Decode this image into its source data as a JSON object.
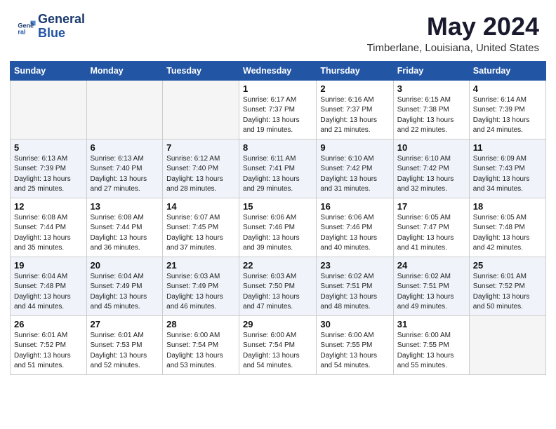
{
  "header": {
    "logo_line1": "General",
    "logo_line2": "Blue",
    "month_title": "May 2024",
    "location": "Timberlane, Louisiana, United States"
  },
  "weekdays": [
    "Sunday",
    "Monday",
    "Tuesday",
    "Wednesday",
    "Thursday",
    "Friday",
    "Saturday"
  ],
  "weeks": [
    [
      {
        "day": "",
        "sunrise": "",
        "sunset": "",
        "daylight": "",
        "empty": true
      },
      {
        "day": "",
        "sunrise": "",
        "sunset": "",
        "daylight": "",
        "empty": true
      },
      {
        "day": "",
        "sunrise": "",
        "sunset": "",
        "daylight": "",
        "empty": true
      },
      {
        "day": "1",
        "sunrise": "Sunrise: 6:17 AM",
        "sunset": "Sunset: 7:37 PM",
        "daylight": "Daylight: 13 hours and 19 minutes."
      },
      {
        "day": "2",
        "sunrise": "Sunrise: 6:16 AM",
        "sunset": "Sunset: 7:37 PM",
        "daylight": "Daylight: 13 hours and 21 minutes."
      },
      {
        "day": "3",
        "sunrise": "Sunrise: 6:15 AM",
        "sunset": "Sunset: 7:38 PM",
        "daylight": "Daylight: 13 hours and 22 minutes."
      },
      {
        "day": "4",
        "sunrise": "Sunrise: 6:14 AM",
        "sunset": "Sunset: 7:39 PM",
        "daylight": "Daylight: 13 hours and 24 minutes."
      }
    ],
    [
      {
        "day": "5",
        "sunrise": "Sunrise: 6:13 AM",
        "sunset": "Sunset: 7:39 PM",
        "daylight": "Daylight: 13 hours and 25 minutes."
      },
      {
        "day": "6",
        "sunrise": "Sunrise: 6:13 AM",
        "sunset": "Sunset: 7:40 PM",
        "daylight": "Daylight: 13 hours and 27 minutes."
      },
      {
        "day": "7",
        "sunrise": "Sunrise: 6:12 AM",
        "sunset": "Sunset: 7:40 PM",
        "daylight": "Daylight: 13 hours and 28 minutes."
      },
      {
        "day": "8",
        "sunrise": "Sunrise: 6:11 AM",
        "sunset": "Sunset: 7:41 PM",
        "daylight": "Daylight: 13 hours and 29 minutes."
      },
      {
        "day": "9",
        "sunrise": "Sunrise: 6:10 AM",
        "sunset": "Sunset: 7:42 PM",
        "daylight": "Daylight: 13 hours and 31 minutes."
      },
      {
        "day": "10",
        "sunrise": "Sunrise: 6:10 AM",
        "sunset": "Sunset: 7:42 PM",
        "daylight": "Daylight: 13 hours and 32 minutes."
      },
      {
        "day": "11",
        "sunrise": "Sunrise: 6:09 AM",
        "sunset": "Sunset: 7:43 PM",
        "daylight": "Daylight: 13 hours and 34 minutes."
      }
    ],
    [
      {
        "day": "12",
        "sunrise": "Sunrise: 6:08 AM",
        "sunset": "Sunset: 7:44 PM",
        "daylight": "Daylight: 13 hours and 35 minutes."
      },
      {
        "day": "13",
        "sunrise": "Sunrise: 6:08 AM",
        "sunset": "Sunset: 7:44 PM",
        "daylight": "Daylight: 13 hours and 36 minutes."
      },
      {
        "day": "14",
        "sunrise": "Sunrise: 6:07 AM",
        "sunset": "Sunset: 7:45 PM",
        "daylight": "Daylight: 13 hours and 37 minutes."
      },
      {
        "day": "15",
        "sunrise": "Sunrise: 6:06 AM",
        "sunset": "Sunset: 7:46 PM",
        "daylight": "Daylight: 13 hours and 39 minutes."
      },
      {
        "day": "16",
        "sunrise": "Sunrise: 6:06 AM",
        "sunset": "Sunset: 7:46 PM",
        "daylight": "Daylight: 13 hours and 40 minutes."
      },
      {
        "day": "17",
        "sunrise": "Sunrise: 6:05 AM",
        "sunset": "Sunset: 7:47 PM",
        "daylight": "Daylight: 13 hours and 41 minutes."
      },
      {
        "day": "18",
        "sunrise": "Sunrise: 6:05 AM",
        "sunset": "Sunset: 7:48 PM",
        "daylight": "Daylight: 13 hours and 42 minutes."
      }
    ],
    [
      {
        "day": "19",
        "sunrise": "Sunrise: 6:04 AM",
        "sunset": "Sunset: 7:48 PM",
        "daylight": "Daylight: 13 hours and 44 minutes."
      },
      {
        "day": "20",
        "sunrise": "Sunrise: 6:04 AM",
        "sunset": "Sunset: 7:49 PM",
        "daylight": "Daylight: 13 hours and 45 minutes."
      },
      {
        "day": "21",
        "sunrise": "Sunrise: 6:03 AM",
        "sunset": "Sunset: 7:49 PM",
        "daylight": "Daylight: 13 hours and 46 minutes."
      },
      {
        "day": "22",
        "sunrise": "Sunrise: 6:03 AM",
        "sunset": "Sunset: 7:50 PM",
        "daylight": "Daylight: 13 hours and 47 minutes."
      },
      {
        "day": "23",
        "sunrise": "Sunrise: 6:02 AM",
        "sunset": "Sunset: 7:51 PM",
        "daylight": "Daylight: 13 hours and 48 minutes."
      },
      {
        "day": "24",
        "sunrise": "Sunrise: 6:02 AM",
        "sunset": "Sunset: 7:51 PM",
        "daylight": "Daylight: 13 hours and 49 minutes."
      },
      {
        "day": "25",
        "sunrise": "Sunrise: 6:01 AM",
        "sunset": "Sunset: 7:52 PM",
        "daylight": "Daylight: 13 hours and 50 minutes."
      }
    ],
    [
      {
        "day": "26",
        "sunrise": "Sunrise: 6:01 AM",
        "sunset": "Sunset: 7:52 PM",
        "daylight": "Daylight: 13 hours and 51 minutes."
      },
      {
        "day": "27",
        "sunrise": "Sunrise: 6:01 AM",
        "sunset": "Sunset: 7:53 PM",
        "daylight": "Daylight: 13 hours and 52 minutes."
      },
      {
        "day": "28",
        "sunrise": "Sunrise: 6:00 AM",
        "sunset": "Sunset: 7:54 PM",
        "daylight": "Daylight: 13 hours and 53 minutes."
      },
      {
        "day": "29",
        "sunrise": "Sunrise: 6:00 AM",
        "sunset": "Sunset: 7:54 PM",
        "daylight": "Daylight: 13 hours and 54 minutes."
      },
      {
        "day": "30",
        "sunrise": "Sunrise: 6:00 AM",
        "sunset": "Sunset: 7:55 PM",
        "daylight": "Daylight: 13 hours and 54 minutes."
      },
      {
        "day": "31",
        "sunrise": "Sunrise: 6:00 AM",
        "sunset": "Sunset: 7:55 PM",
        "daylight": "Daylight: 13 hours and 55 minutes."
      },
      {
        "day": "",
        "sunrise": "",
        "sunset": "",
        "daylight": "",
        "empty": true
      }
    ]
  ]
}
